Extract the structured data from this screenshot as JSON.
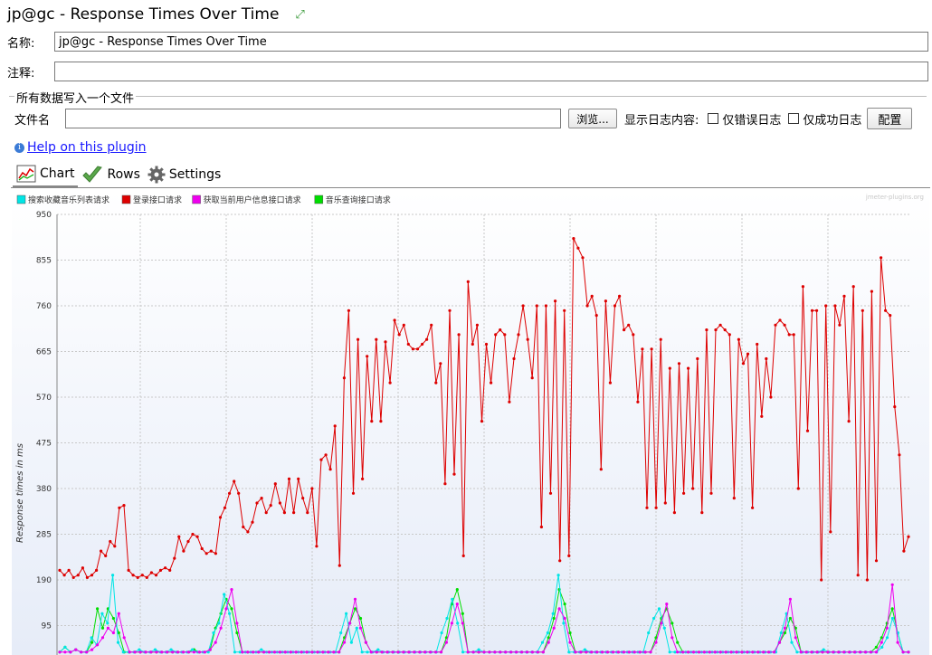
{
  "window": {
    "title": "jp@gc - Response Times Over Time"
  },
  "form": {
    "name_label": "名称:",
    "name_value": "jp@gc - Response Times Over Time",
    "comment_label": "注释:",
    "comment_value": "",
    "group_title": "所有数据写入一个文件",
    "file_label": "文件名",
    "file_value": "",
    "browse_label": "浏览...",
    "log_label": "显示日志内容:",
    "errors_only_label": "仅错误日志",
    "success_only_label": "仅成功日志",
    "config_label": "配置"
  },
  "help": {
    "link": "Help on this plugin"
  },
  "tabs": [
    {
      "label": "Chart",
      "icon": "chart-icon",
      "active": true
    },
    {
      "label": "Rows",
      "icon": "checkmark-icon",
      "active": false
    },
    {
      "label": "Settings",
      "icon": "gear-icon",
      "active": false
    }
  ],
  "chart_data": {
    "type": "line",
    "watermark": "jmeter-plugins.org",
    "ylabel": "Response times in ms",
    "ylim": [
      0,
      950
    ],
    "yticks": [
      95,
      190,
      285,
      380,
      475,
      570,
      665,
      760,
      855,
      950
    ],
    "grid": true,
    "legend_position": "top-left",
    "series": [
      {
        "name": "搜索收藏音乐列表请求",
        "color": "#00e5e5",
        "values": [
          40,
          50,
          40,
          45,
          40,
          40,
          70,
          55,
          120,
          100,
          200,
          60,
          40,
          40,
          40,
          45,
          40,
          40,
          45,
          40,
          40,
          45,
          40,
          40,
          40,
          45,
          40,
          40,
          40,
          80,
          100,
          160,
          120,
          40,
          40,
          40,
          40,
          40,
          45,
          40,
          40,
          40,
          40,
          40,
          40,
          40,
          40,
          40,
          40,
          40,
          40,
          40,
          40,
          80,
          120,
          60,
          90,
          40,
          40,
          40,
          45,
          40,
          40,
          40,
          40,
          40,
          40,
          40,
          40,
          40,
          40,
          40,
          80,
          110,
          150,
          100,
          40,
          40,
          40,
          45,
          40,
          40,
          40,
          40,
          40,
          40,
          40,
          40,
          40,
          40,
          40,
          60,
          80,
          120,
          200,
          100,
          40,
          40,
          40,
          45,
          40,
          40,
          40,
          40,
          40,
          40,
          40,
          40,
          40,
          40,
          40,
          80,
          110,
          130,
          90,
          40,
          40,
          40,
          40,
          40,
          40,
          40,
          40,
          40,
          40,
          40,
          40,
          40,
          40,
          40,
          40,
          40,
          40,
          40,
          40,
          40,
          80,
          120,
          60,
          40,
          40,
          40,
          40,
          40,
          45,
          40,
          40,
          40,
          40,
          40,
          40,
          40,
          40,
          40,
          40,
          50,
          70,
          110,
          80,
          40,
          40
        ]
      },
      {
        "name": "登录接口请求",
        "color": "#dd0000",
        "values": [
          210,
          200,
          210,
          195,
          200,
          215,
          195,
          200,
          210,
          250,
          240,
          270,
          260,
          340,
          345,
          210,
          200,
          195,
          200,
          195,
          205,
          200,
          210,
          215,
          210,
          235,
          280,
          250,
          270,
          285,
          280,
          255,
          245,
          250,
          245,
          320,
          340,
          370,
          395,
          370,
          300,
          290,
          310,
          350,
          360,
          330,
          345,
          390,
          350,
          330,
          400,
          330,
          400,
          360,
          330,
          380,
          260,
          440,
          450,
          420,
          510,
          220,
          610,
          750,
          370,
          690,
          400,
          655,
          520,
          690,
          520,
          685,
          600,
          730,
          700,
          720,
          680,
          670,
          670,
          680,
          690,
          720,
          600,
          640,
          390,
          750,
          410,
          700,
          240,
          810,
          680,
          720,
          520,
          680,
          600,
          700,
          710,
          700,
          560,
          650,
          700,
          760,
          690,
          610,
          760,
          300,
          760,
          370,
          770,
          230,
          750,
          240,
          900,
          880,
          860,
          760,
          780,
          740,
          420,
          770,
          600,
          760,
          780,
          710,
          720,
          700,
          560,
          670,
          340,
          670,
          340,
          690,
          350,
          630,
          330,
          640,
          370,
          630,
          380,
          650,
          330,
          710,
          370,
          710,
          720,
          710,
          700,
          360,
          690,
          640,
          660,
          340,
          680,
          530,
          650,
          570,
          720,
          730,
          720,
          700,
          700,
          380,
          800,
          500,
          750,
          750,
          190,
          760,
          290,
          760,
          720,
          780,
          520,
          800,
          200,
          750,
          190,
          790,
          230,
          860,
          750,
          740,
          550,
          450,
          250,
          280
        ]
      },
      {
        "name": "获取当前用户信息接口请求",
        "color": "#ee00ee",
        "values": [
          40,
          40,
          40,
          45,
          40,
          40,
          45,
          55,
          70,
          90,
          80,
          120,
          70,
          40,
          40,
          40,
          40,
          40,
          40,
          40,
          40,
          40,
          40,
          40,
          40,
          40,
          40,
          40,
          45,
          60,
          90,
          130,
          170,
          100,
          40,
          40,
          40,
          40,
          40,
          40,
          40,
          40,
          40,
          40,
          40,
          40,
          40,
          40,
          40,
          40,
          40,
          40,
          40,
          60,
          100,
          150,
          90,
          60,
          40,
          40,
          40,
          40,
          40,
          40,
          40,
          40,
          40,
          40,
          40,
          40,
          40,
          40,
          60,
          100,
          140,
          100,
          40,
          40,
          40,
          40,
          40,
          40,
          40,
          40,
          40,
          40,
          40,
          40,
          40,
          40,
          40,
          60,
          90,
          130,
          110,
          60,
          40,
          40,
          40,
          40,
          40,
          40,
          40,
          40,
          40,
          40,
          40,
          40,
          40,
          40,
          40,
          60,
          100,
          140,
          70,
          40,
          40,
          40,
          40,
          40,
          40,
          40,
          40,
          40,
          40,
          40,
          40,
          40,
          40,
          40,
          40,
          40,
          40,
          40,
          60,
          90,
          150,
          70,
          40,
          40,
          40,
          40,
          40,
          40,
          40,
          40,
          40,
          40,
          40,
          40,
          40,
          40,
          40,
          60,
          90,
          180,
          60,
          40,
          40
        ]
      },
      {
        "name": "音乐查询接口请求",
        "color": "#00dd00",
        "values": [
          40,
          50,
          40,
          45,
          40,
          40,
          60,
          130,
          90,
          130,
          110,
          80,
          40,
          40,
          40,
          40,
          40,
          40,
          40,
          40,
          40,
          40,
          40,
          40,
          40,
          45,
          40,
          40,
          45,
          90,
          120,
          150,
          130,
          80,
          40,
          40,
          40,
          40,
          40,
          40,
          40,
          40,
          40,
          40,
          40,
          40,
          40,
          40,
          40,
          40,
          40,
          40,
          40,
          70,
          100,
          130,
          110,
          60,
          40,
          40,
          40,
          40,
          40,
          40,
          40,
          40,
          40,
          40,
          40,
          40,
          40,
          40,
          70,
          140,
          170,
          120,
          40,
          40,
          40,
          40,
          40,
          40,
          40,
          40,
          40,
          40,
          40,
          40,
          40,
          40,
          40,
          70,
          110,
          170,
          140,
          80,
          40,
          40,
          40,
          40,
          40,
          40,
          40,
          40,
          40,
          40,
          40,
          40,
          40,
          40,
          40,
          70,
          110,
          130,
          100,
          60,
          40,
          40,
          40,
          40,
          40,
          40,
          40,
          40,
          40,
          40,
          40,
          40,
          40,
          40,
          40,
          40,
          40,
          40,
          60,
          80,
          110,
          90,
          40,
          40,
          40,
          40,
          40,
          40,
          40,
          40,
          40,
          40,
          40,
          40,
          40,
          40,
          50,
          70,
          100,
          130,
          80,
          40,
          40
        ]
      }
    ]
  }
}
